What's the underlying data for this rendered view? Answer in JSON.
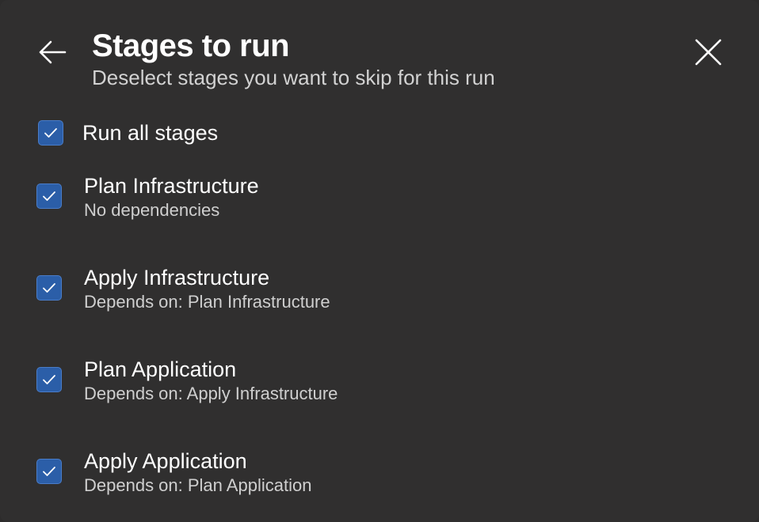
{
  "header": {
    "title": "Stages to run",
    "subtitle": "Deselect stages you want to skip for this run",
    "back_icon": "arrow-left-icon",
    "close_icon": "close-icon"
  },
  "run_all": {
    "label": "Run all stages",
    "checked": true
  },
  "stages": [
    {
      "name": "Plan Infrastructure",
      "dependency": "No dependencies",
      "checked": true
    },
    {
      "name": "Apply Infrastructure",
      "dependency": "Depends on: Plan Infrastructure",
      "checked": true
    },
    {
      "name": "Plan Application",
      "dependency": "Depends on: Apply Infrastructure",
      "checked": true
    },
    {
      "name": "Apply Application",
      "dependency": "Depends on: Plan Application",
      "checked": true
    }
  ],
  "colors": {
    "background": "#302f2f",
    "checkbox_fill": "#2b5ea8",
    "text_primary": "#ffffff",
    "text_secondary": "#cfcfcf"
  }
}
